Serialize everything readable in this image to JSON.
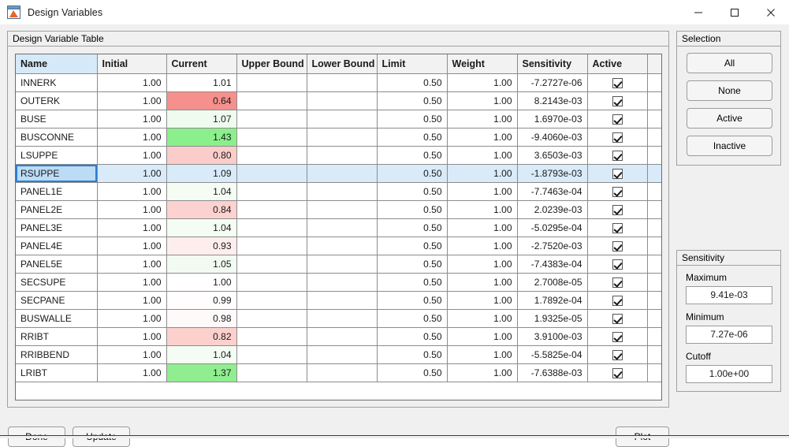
{
  "window": {
    "title": "Design Variables",
    "icon": "matlab-icon",
    "controls": {
      "minimize": "minimize-icon",
      "maximize": "maximize-icon",
      "close": "close-icon"
    }
  },
  "table_panel": {
    "title": "Design Variable Table",
    "columns": [
      "Name",
      "Initial",
      "Current",
      "Upper Bound",
      "Lower Bound",
      "Limit",
      "Weight",
      "Sensitivity",
      "Active"
    ],
    "selected_row_index": 5,
    "rows": [
      {
        "name": "INNERK",
        "initial": "1.00",
        "current": "1.01",
        "upper": "",
        "lower": "",
        "limit": "0.50",
        "weight": "1.00",
        "sensitivity": "-7.2727e-06",
        "active": true,
        "current_color": "#ffffff"
      },
      {
        "name": "OUTERK",
        "initial": "1.00",
        "current": "0.64",
        "upper": "",
        "lower": "",
        "limit": "0.50",
        "weight": "1.00",
        "sensitivity": "8.2143e-03",
        "active": true,
        "current_color": "#f5908c"
      },
      {
        "name": "BUSE",
        "initial": "1.00",
        "current": "1.07",
        "upper": "",
        "lower": "",
        "limit": "0.50",
        "weight": "1.00",
        "sensitivity": "1.6970e-03",
        "active": true,
        "current_color": "#f0fbf0"
      },
      {
        "name": "BUSCONNE",
        "initial": "1.00",
        "current": "1.43",
        "upper": "",
        "lower": "",
        "limit": "0.50",
        "weight": "1.00",
        "sensitivity": "-9.4060e-03",
        "active": true,
        "current_color": "#8bf08b"
      },
      {
        "name": "LSUPPE",
        "initial": "1.00",
        "current": "0.80",
        "upper": "",
        "lower": "",
        "limit": "0.50",
        "weight": "1.00",
        "sensitivity": "3.6503e-03",
        "active": true,
        "current_color": "#fbcdca"
      },
      {
        "name": "RSUPPE",
        "initial": "1.00",
        "current": "1.09",
        "upper": "",
        "lower": "",
        "limit": "0.50",
        "weight": "1.00",
        "sensitivity": "-1.8793e-03",
        "active": true,
        "current_color": "#e9f8e9"
      },
      {
        "name": "PANEL1E",
        "initial": "1.00",
        "current": "1.04",
        "upper": "",
        "lower": "",
        "limit": "0.50",
        "weight": "1.00",
        "sensitivity": "-7.7463e-04",
        "active": true,
        "current_color": "#f4fcf4"
      },
      {
        "name": "PANEL2E",
        "initial": "1.00",
        "current": "0.84",
        "upper": "",
        "lower": "",
        "limit": "0.50",
        "weight": "1.00",
        "sensitivity": "2.0239e-03",
        "active": true,
        "current_color": "#fbd2cf"
      },
      {
        "name": "PANEL3E",
        "initial": "1.00",
        "current": "1.04",
        "upper": "",
        "lower": "",
        "limit": "0.50",
        "weight": "1.00",
        "sensitivity": "-5.0295e-04",
        "active": true,
        "current_color": "#f4fcf4"
      },
      {
        "name": "PANEL4E",
        "initial": "1.00",
        "current": "0.93",
        "upper": "",
        "lower": "",
        "limit": "0.50",
        "weight": "1.00",
        "sensitivity": "-2.7520e-03",
        "active": true,
        "current_color": "#fdeeed"
      },
      {
        "name": "PANEL5E",
        "initial": "1.00",
        "current": "1.05",
        "upper": "",
        "lower": "",
        "limit": "0.50",
        "weight": "1.00",
        "sensitivity": "-7.4383e-04",
        "active": true,
        "current_color": "#f2fbf2"
      },
      {
        "name": "SECSUPE",
        "initial": "1.00",
        "current": "1.00",
        "upper": "",
        "lower": "",
        "limit": "0.50",
        "weight": "1.00",
        "sensitivity": "2.7008e-05",
        "active": true,
        "current_color": "#ffffff"
      },
      {
        "name": "SECPANE",
        "initial": "1.00",
        "current": "0.99",
        "upper": "",
        "lower": "",
        "limit": "0.50",
        "weight": "1.00",
        "sensitivity": "1.7892e-04",
        "active": true,
        "current_color": "#fffdfd"
      },
      {
        "name": "BUSWALLE",
        "initial": "1.00",
        "current": "0.98",
        "upper": "",
        "lower": "",
        "limit": "0.50",
        "weight": "1.00",
        "sensitivity": "1.9325e-05",
        "active": true,
        "current_color": "#fffafa"
      },
      {
        "name": "RRIBT",
        "initial": "1.00",
        "current": "0.82",
        "upper": "",
        "lower": "",
        "limit": "0.50",
        "weight": "1.00",
        "sensitivity": "3.9100e-03",
        "active": true,
        "current_color": "#fbd0cd"
      },
      {
        "name": "RRIBBEND",
        "initial": "1.00",
        "current": "1.04",
        "upper": "",
        "lower": "",
        "limit": "0.50",
        "weight": "1.00",
        "sensitivity": "-5.5825e-04",
        "active": true,
        "current_color": "#f4fcf4"
      },
      {
        "name": "LRIBT",
        "initial": "1.00",
        "current": "1.37",
        "upper": "",
        "lower": "",
        "limit": "0.50",
        "weight": "1.00",
        "sensitivity": "-7.6388e-03",
        "active": true,
        "current_color": "#90ee90"
      }
    ]
  },
  "selection_panel": {
    "title": "Selection",
    "buttons": [
      {
        "label": "All"
      },
      {
        "label": "None"
      },
      {
        "label": "Active"
      },
      {
        "label": "Inactive"
      }
    ]
  },
  "sensitivity_panel": {
    "title": "Sensitivity",
    "fields": [
      {
        "label": "Maximum",
        "value": "9.41e-03"
      },
      {
        "label": "Minimum",
        "value": "7.27e-06"
      },
      {
        "label": "Cutoff",
        "value": "1.00e+00"
      }
    ]
  },
  "footer": {
    "done_label": "Done",
    "update_label": "Update",
    "plot_label": "Plot"
  }
}
